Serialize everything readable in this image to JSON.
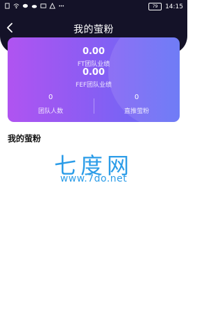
{
  "status_bar": {
    "battery": "79",
    "time": "14:15"
  },
  "header": {
    "title": "我的萤粉"
  },
  "card": {
    "ft_value": "0.00",
    "ft_label": "FT团队业绩",
    "fef_value": "0.00",
    "fef_label": "FEF团队业绩",
    "team_count_value": "0",
    "team_count_label": "团队人数",
    "direct_value": "0",
    "direct_label": "直推萤粉"
  },
  "section": {
    "title": "我的萤粉"
  },
  "watermark": {
    "title": "七度网",
    "url": "www.7do.net"
  },
  "colors": {
    "header_bg": "#141228",
    "gradient_start": "#b054f1",
    "gradient_end": "#5f6ef5",
    "watermark": "#2b9ce8"
  }
}
